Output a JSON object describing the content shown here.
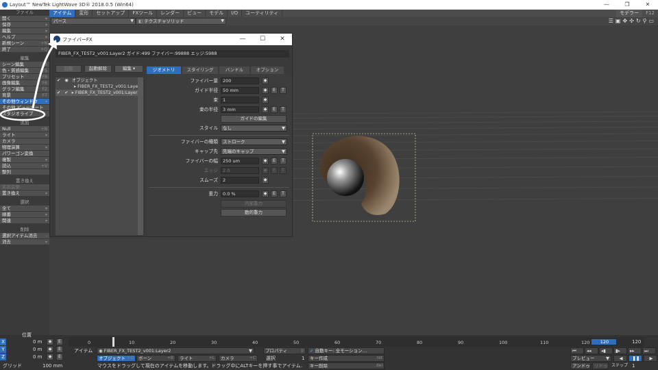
{
  "app_title": "Layout™ NewTek LightWave 3D® 2018.0.5 (Win64)",
  "window_buttons": [
    "—",
    "❐",
    "✕"
  ],
  "menu_tabs": [
    "アイテム",
    "変形",
    "セットアップ",
    "FXツール",
    "レンダー",
    "ビュー",
    "モデル",
    "I/O",
    "ユーティリティ"
  ],
  "modeler_btn": "モデラー",
  "modeler_key": "F12",
  "sidebar": {
    "file": "ファイル",
    "file_items": [
      {
        "label": "開く",
        "key": "▾"
      },
      {
        "label": "保存",
        "key": "▾"
      },
      {
        "label": "編集",
        "key": "▾"
      },
      {
        "label": "ヘルプ",
        "key": "▾"
      },
      {
        "label": "新規シーン",
        "key": "+N"
      },
      {
        "label": "終了",
        "key": "+Q"
      }
    ],
    "edit": "編集",
    "edit_items": [
      {
        "label": "シーン編集",
        "key": "F3"
      },
      {
        "label": "色・質感編集",
        "key": "F5"
      },
      {
        "label": "プリセット",
        "key": "F8"
      },
      {
        "label": "画像編集",
        "key": "F6"
      },
      {
        "label": "グラフ編集",
        "key": "F2"
      },
      {
        "label": "背景",
        "key": "F7"
      },
      {
        "label": "その他ウィンドウ",
        "key": "▾",
        "hl": true
      },
      {
        "label": "その他 ビューポート",
        "key": ""
      },
      {
        "label": "スタジオライブ",
        "key": ""
      }
    ],
    "add": "追加",
    "add_items": [
      {
        "label": "Null",
        "key": "+N"
      },
      {
        "label": "ライト",
        "key": "▾"
      },
      {
        "label": "カメラ",
        "key": ""
      },
      {
        "label": "物理演算",
        "key": "▾"
      },
      {
        "label": "パワーゴン変換",
        "key": ""
      },
      {
        "label": "複製",
        "key": "▾"
      },
      {
        "label": "読込",
        "key": "+V"
      },
      {
        "label": "整列",
        "key": ""
      }
    ],
    "replace": "置き換え",
    "replace_items": [
      {
        "label": "名前変更",
        "key": "",
        "dim": true
      },
      {
        "label": "置き換え",
        "key": "▾"
      }
    ],
    "select": "選択",
    "select_items": [
      {
        "label": "全て",
        "key": "▾"
      },
      {
        "label": "順番",
        "key": "▾"
      },
      {
        "label": "関連",
        "key": "▾"
      }
    ],
    "delete": "削除",
    "delete_items": [
      {
        "label": "選択アイテム消去",
        "key": "-"
      },
      {
        "label": "消去",
        "key": "▾"
      }
    ]
  },
  "view_bar": {
    "view_mode": "パース",
    "render_mode": "テクスチャソリッド"
  },
  "fiber_window": {
    "title": "ファイバーFX",
    "info": "FIBER_FX_TEST2_v001:Layer2 ガイド:499 ファイバー:99888 エッジ:5988",
    "top_buttons": [
      "起動",
      "起動解除",
      "編集 ▾"
    ],
    "tabs": [
      "ジオメトリ",
      "スタイリング",
      "バンドル",
      "オプション"
    ],
    "tree": [
      {
        "label": "オブジェクト",
        "depth": 0
      },
      {
        "label": "FIBER_FX_TEST2_v001:Layer1",
        "depth": 1
      },
      {
        "label": "FIBER_FX_TEST2_v001:Layer2",
        "depth": 1
      }
    ],
    "props": {
      "fiber_amount": {
        "label": "ファイバー量",
        "value": "200"
      },
      "guide_radius": {
        "label": "ガイド半径",
        "value": "50 mm"
      },
      "bundle": {
        "label": "束",
        "value": "1"
      },
      "bundle_radius": {
        "label": "束の半径",
        "value": "3 mm"
      },
      "guide_edit": "ガイドの編集",
      "style": {
        "label": "スタイル",
        "value": "なし"
      },
      "fiber_type": {
        "label": "ファイバーの種類",
        "value": "ストローク"
      },
      "cap": {
        "label": "キャップ先",
        "value": "先端のキャップ"
      },
      "fiber_width": {
        "label": "ファイバーの幅",
        "value": "250 um"
      },
      "edge": {
        "label": "エッジ",
        "value": "2.0"
      },
      "smooth": {
        "label": "スムーズ",
        "value": "2"
      },
      "gravity": {
        "label": "重力",
        "value": "0.0 %"
      },
      "fiber_gravity": "内部重力",
      "dynamic_gravity": "動的重力"
    }
  },
  "bottom": {
    "position": "位置",
    "axes": [
      {
        "axis": "X",
        "value": "0 m"
      },
      {
        "axis": "Y",
        "value": "0 m"
      },
      {
        "axis": "Z",
        "value": "0 m"
      }
    ],
    "grid_label": "グリッド",
    "grid_value": "100 mm",
    "ticks": [
      "0",
      "10",
      "20",
      "30",
      "40",
      "50",
      "60",
      "70",
      "80",
      "90",
      "100",
      "110",
      "120"
    ],
    "frame_current": "120",
    "frame_end": "120",
    "item_label": "アイテム",
    "item_value": "FIBER_FX_TEST2_v001:Layer2",
    "modes": [
      {
        "label": "オブジェクト",
        "key": "+O",
        "hl": true
      },
      {
        "label": "ボーン",
        "key": "+B"
      },
      {
        "label": "ライト",
        "key": "+L"
      },
      {
        "label": "カメラ",
        "key": "+C"
      }
    ],
    "property": "プロパティ",
    "property_key": "p",
    "select_label": "選択",
    "select_count": "1",
    "auto_key": "自動キー: 全モーション…",
    "create_key": "キー作成",
    "create_key_hint": "ret",
    "delete_key": "キー削除",
    "delete_key_hint": "del",
    "status": "マウスをドラッグして現在のアイテムを移動します。ドラッグ中にALTキーを押す事でアイテム…",
    "preview": "プレビュー",
    "undo": "アンドゥ",
    "redo": "リドゥ",
    "step_label": "ステップ",
    "step_value": "1"
  }
}
